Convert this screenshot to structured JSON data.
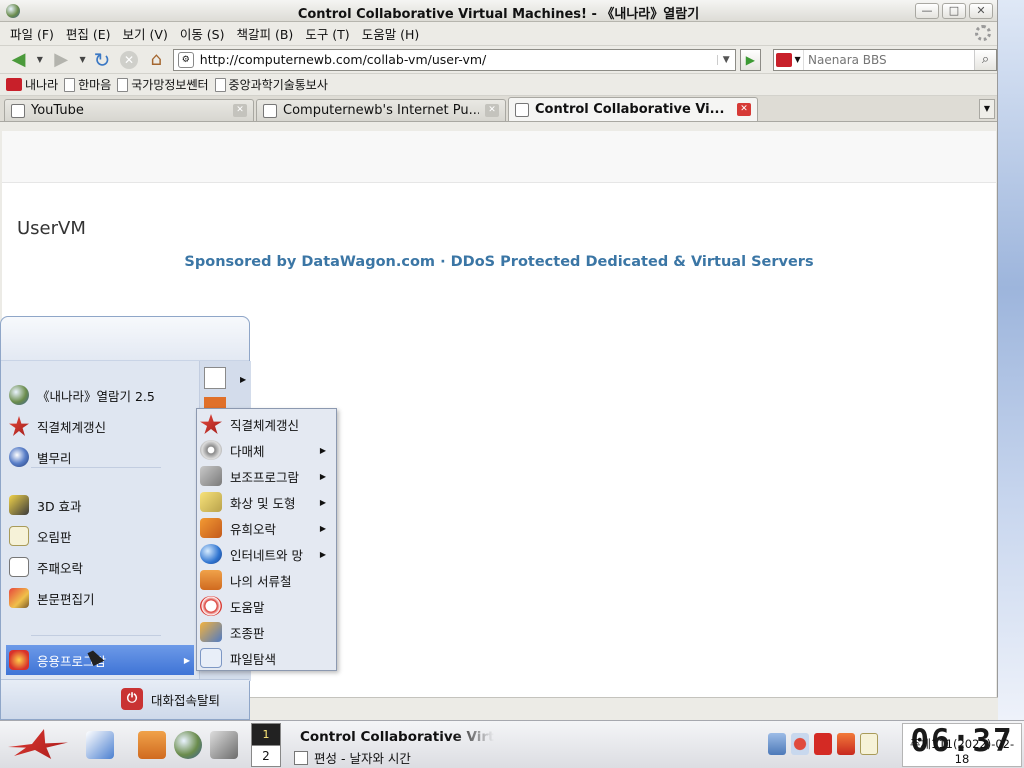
{
  "window": {
    "title": "Control Collaborative Virtual Machines! - 《내나라》열람기",
    "controls": {
      "minimize": "—",
      "maximize": "□",
      "close": "✕"
    }
  },
  "menubar": [
    "파일 (F)",
    "편집 (E)",
    "보기 (V)",
    "이동 (S)",
    "책갈피 (B)",
    "도구 (T)",
    "도움말 (H)"
  ],
  "navigation": {
    "url": "http://computernewb.com/collab-vm/user-vm/",
    "search_placeholder": "Naenara BBS",
    "icons": [
      "back-icon",
      "forward-icon",
      "reload-icon",
      "stop-icon",
      "home-icon"
    ]
  },
  "bookmarks": [
    "내나라",
    "한마음",
    "국가망정보쎈터",
    "중앙과학기술통보사"
  ],
  "tabs": [
    {
      "label": "YouTube",
      "active": false
    },
    {
      "label": "Computernewb's Internet Pu...",
      "active": false
    },
    {
      "label": "Control Collaborative Vi...",
      "active": true
    }
  ],
  "page": {
    "title": "UserVM",
    "sponsor": "Sponsored by DataWagon.com · DDoS Protected Dedicated & Virtual Servers",
    "sponsor_color": "#3b76a5"
  },
  "start_menu": {
    "items": [
      {
        "label": "《내나라》열람기 2.5",
        "icon": "globe-icon"
      },
      {
        "label": "직결체계갱신",
        "icon": "star-update-icon"
      },
      {
        "label": "별무리",
        "icon": "stars-icon"
      },
      {
        "label": "3D 효과",
        "icon": "3d-effect-icon"
      },
      {
        "label": "오림판",
        "icon": "clipboard-icon"
      },
      {
        "label": "주패오락",
        "icon": "cards-icon"
      },
      {
        "label": "본문편집기",
        "icon": "text-editor-icon"
      },
      {
        "label": "응용프로그람",
        "icon": "applications-icon",
        "selected": true
      }
    ],
    "logout": "대화접속탈퇴"
  },
  "submenu": [
    {
      "label": "직결체계갱신",
      "submenu": false
    },
    {
      "label": "다매체",
      "submenu": true
    },
    {
      "label": "보조프로그람",
      "submenu": true
    },
    {
      "label": "화상 및 도형",
      "submenu": true
    },
    {
      "label": "유희오락",
      "submenu": true
    },
    {
      "label": "인터네트와 망",
      "submenu": true
    },
    {
      "label": "나의 서류철",
      "submenu": false
    },
    {
      "label": "도움말",
      "submenu": false
    },
    {
      "label": "조종판",
      "submenu": false
    },
    {
      "label": "파일탐색",
      "submenu": false
    }
  ],
  "taskbar": {
    "workspaces": [
      "1",
      "2"
    ],
    "tasks": [
      "Control Collaborative Virtual Machines! - 《내나라》열람기",
      "편성 - 날자와 시간"
    ],
    "clock_time": "06:37",
    "clock_date": "주체111(2022)-02-18"
  }
}
